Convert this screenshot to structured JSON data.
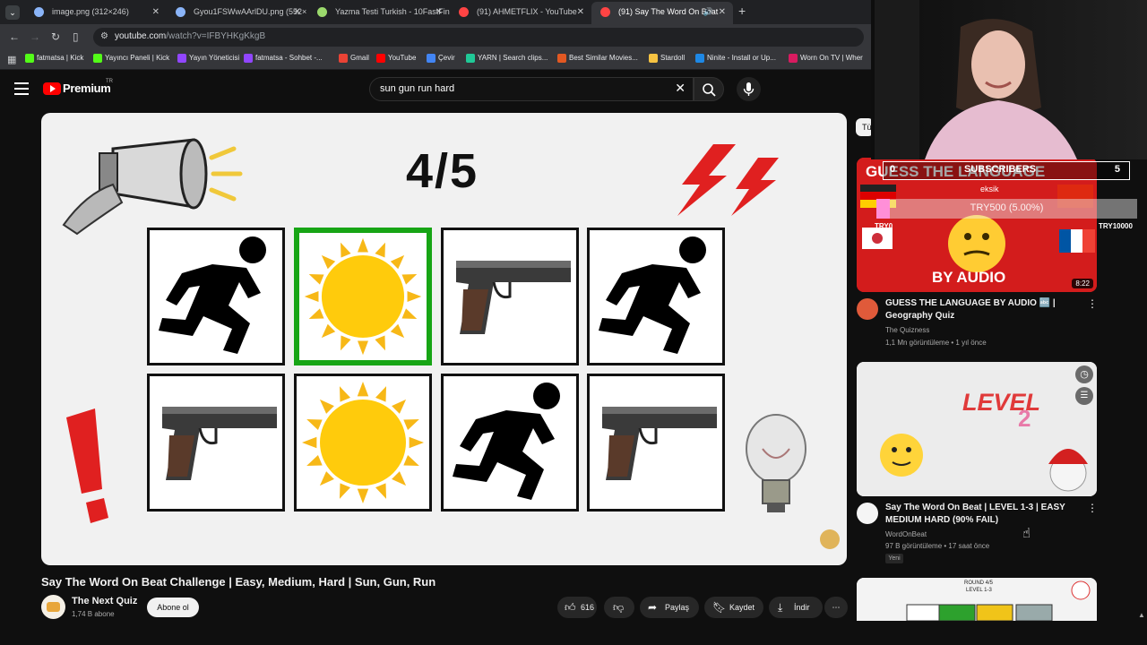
{
  "browser": {
    "tabs": [
      {
        "title": "image.png (312×246)",
        "color": "#8ab4f8",
        "active": false
      },
      {
        "title": "Gyou1FSWwAArlDU.png (552×",
        "color": "#8ab4f8",
        "active": false
      },
      {
        "title": "Yazma Testi Turkish - 10FastFing",
        "color": "#9bd96c",
        "active": false
      },
      {
        "title": "(91) AHMETFLIX - YouTube",
        "color": "#ff4444",
        "active": false
      },
      {
        "title": "(91) Say The Word On Beat",
        "color": "#ff4444",
        "active": true
      }
    ],
    "url_host": "youtube.com",
    "url_path": "/watch?v=IFBYHKgKkgB",
    "bookmarks": [
      {
        "label": "fatmatsa | Kick",
        "color": "#53fc18"
      },
      {
        "label": "Yayıncı Paneli | Kick",
        "color": "#53fc18"
      },
      {
        "label": "Yayın Yöneticisi",
        "color": "#9146ff"
      },
      {
        "label": "fatmatsa - Sohbet -...",
        "color": "#9146ff"
      },
      {
        "label": "Gmail",
        "color": "#ea4335"
      },
      {
        "label": "YouTube",
        "color": "#ff0000"
      },
      {
        "label": "Çevir",
        "color": "#4285f4"
      },
      {
        "label": "YARN | Search clips...",
        "color": "#20c997"
      },
      {
        "label": "Best Similar Movies...",
        "color": "#e25822"
      },
      {
        "label": "Stardoll",
        "color": "#f6c342"
      },
      {
        "label": "Ninite - Install or Up...",
        "color": "#1e88e5"
      },
      {
        "label": "Worn On TV | Wher",
        "color": "#d81b60"
      }
    ]
  },
  "youtube": {
    "logo_text": "Premium",
    "region": "TR",
    "search_query": "sun gun run hard"
  },
  "video": {
    "score_text": "4/5",
    "grid": [
      "run",
      "sun",
      "gun",
      "run",
      "gun",
      "sun",
      "run",
      "gun"
    ],
    "highlighted_index": 1,
    "title": "Say The Word On Beat Challenge | Easy, Medium, Hard | Sun, Gun, Run",
    "channel_name": "The Next Quiz",
    "channel_subs": "1,74 B abone",
    "subscribe_label": "Abone ol",
    "likes": "616",
    "share_label": "Paylaş",
    "save_label": "Kaydet",
    "download_label": "İndir"
  },
  "sidebar": {
    "chip_label": "Tü",
    "related": [
      {
        "title": "GUESS THE LANGUAGE BY AUDIO 🔤 | Geography Quiz",
        "channel": "The Quizness",
        "meta": "1,1 Mn görüntüleme • 1 yıl önce",
        "duration": "8:22",
        "thumb_text_top": "GUESS THE LANGUAGE",
        "thumb_text_bottom": "BY AUDIO",
        "is_new": false
      },
      {
        "title": "Say The Word On Beat | LEVEL 1-3 | EASY MEDIUM HARD (90% FAIL)",
        "channel": "WordOnBeat",
        "meta": "97 B görüntüleme • 17 saat önce",
        "duration": "",
        "thumb_text_top": "LEVEL",
        "thumb_text_bottom": "2",
        "is_new": true,
        "new_label": "Yeni"
      },
      {
        "title": "",
        "channel": "",
        "meta": "",
        "thumb_text_top": "ROUND 4/5",
        "thumb_text_bottom": "LEVEL 1-3"
      }
    ]
  },
  "stream_overlay": {
    "subs_label": "SUBSCRIBERS",
    "subs_current": "0",
    "subs_target": "5",
    "side_label": "eksik",
    "donation_progress_text": "TRY500 (5.00%)",
    "donation_progress": 0.05,
    "donation_current": "TRY0",
    "donation_goal": "TRY10000"
  }
}
